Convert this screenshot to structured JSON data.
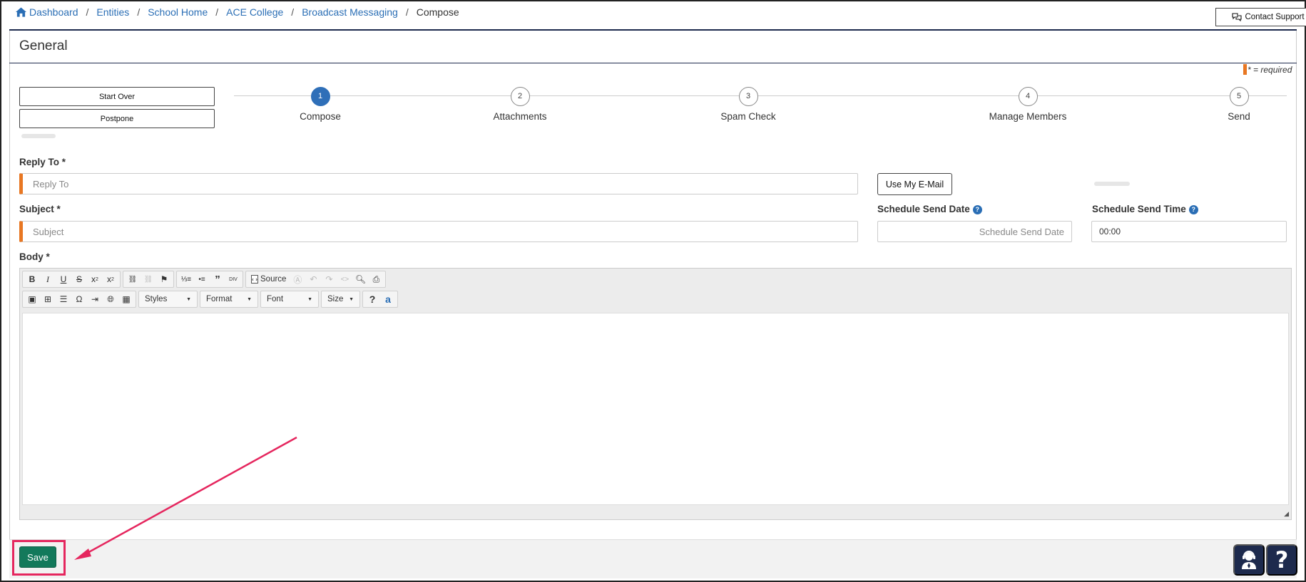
{
  "breadcrumb": {
    "items": [
      "Dashboard",
      "Entities",
      "School Home",
      "ACE College",
      "Broadcast Messaging"
    ],
    "current": "Compose",
    "separator": "/"
  },
  "header": {
    "support_label": "Contact Support",
    "title": "General",
    "required_note": "* = required"
  },
  "actions": {
    "start_over": "Start Over",
    "postpone": "Postpone"
  },
  "steps": [
    {
      "number": "1",
      "label": "Compose",
      "active": true
    },
    {
      "number": "2",
      "label": "Attachments",
      "active": false
    },
    {
      "number": "3",
      "label": "Spam Check",
      "active": false
    },
    {
      "number": "4",
      "label": "Manage Members",
      "active": false
    },
    {
      "number": "5",
      "label": "Send",
      "active": false
    }
  ],
  "form": {
    "reply_to": {
      "label": "Reply To *",
      "placeholder": "Reply To"
    },
    "use_email_label": "Use My E-Mail",
    "subject": {
      "label": "Subject *",
      "placeholder": "Subject"
    },
    "schedule_date": {
      "label": "Schedule Send Date",
      "placeholder": "Schedule Send Date"
    },
    "schedule_time": {
      "label": "Schedule Send Time",
      "value": "00:00"
    },
    "body_label": "Body *"
  },
  "editor": {
    "source_label": "Source",
    "combos": [
      "Styles",
      "Format",
      "Font",
      "Size"
    ]
  },
  "footer": {
    "save_label": "Save"
  },
  "colors": {
    "accent": "#2f6fb8",
    "required": "#e87722",
    "save": "#13795b",
    "highlight": "#e5265e",
    "navy": "#1d2a4d"
  }
}
